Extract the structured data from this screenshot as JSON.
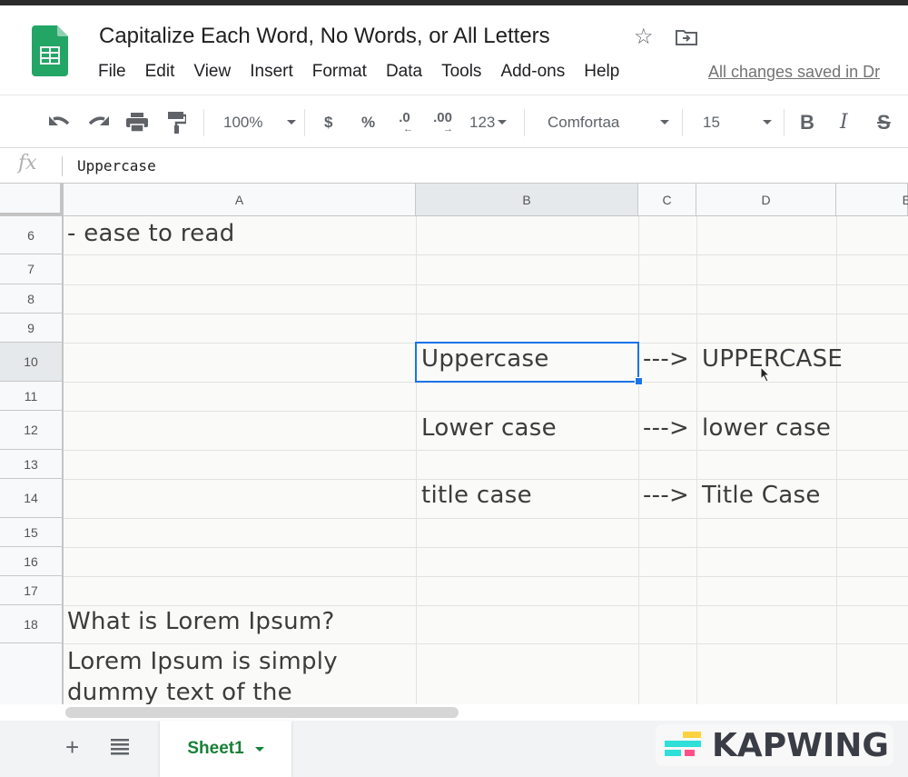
{
  "app": {
    "doc_title": "Capitalize Each Word, No Words, or All Letters",
    "icons": {
      "logo": "google-sheets-logo",
      "star": "star-icon",
      "move": "move-to-folder-icon"
    },
    "menu": [
      "File",
      "Edit",
      "View",
      "Insert",
      "Format",
      "Data",
      "Tools",
      "Add-ons",
      "Help"
    ],
    "save_status": "All changes saved in Dr"
  },
  "toolbar": {
    "zoom": "100%",
    "currency": "$",
    "percent": "%",
    "decrease_decimal": ".0",
    "increase_decimal": ".00",
    "more_formats": "123",
    "font": "Comfortaa",
    "font_size": "15",
    "bold": "B",
    "italic": "I",
    "strikethrough": "S"
  },
  "formula_bar": {
    "fx_label": "fx",
    "value": "Uppercase"
  },
  "sheet": {
    "columns": [
      "A",
      "B",
      "C",
      "D",
      "E"
    ],
    "selected_column": "B",
    "selected_row": "10",
    "rows": [
      "6",
      "7",
      "8",
      "9",
      "10",
      "11",
      "12",
      "13",
      "14",
      "15",
      "16",
      "17",
      "18",
      ""
    ],
    "cells": {
      "A6": "- ease to read",
      "B10": "Uppercase",
      "C10": "--->",
      "D10": "UPPERCASE",
      "B12": "Lower case",
      "C12": "--->",
      "D12": "lower case",
      "B14": "title case",
      "C14": "--->",
      "D14": "Title Case",
      "A18": "What is Lorem Ipsum?",
      "A19_line1": "Lorem Ipsum is simply",
      "A19_line2": "dummy text of the"
    },
    "selection_color": "#1a73e8"
  },
  "bottom": {
    "add_sheet": "+",
    "sheet_list": "all-sheets-icon",
    "tabs": [
      {
        "label": "Sheet1",
        "active": true
      }
    ],
    "active_tab_color": "#188038"
  },
  "watermark": {
    "text": "KAPWING",
    "colors": [
      "#ffd23f",
      "#2ee0d8",
      "#ff4f8b"
    ]
  }
}
